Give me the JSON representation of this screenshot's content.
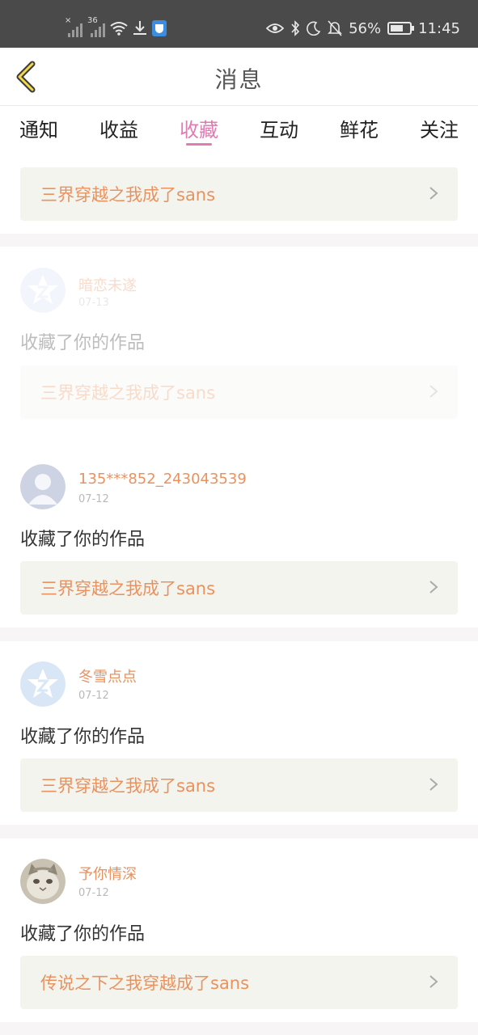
{
  "status_bar": {
    "signal1_tag": "×",
    "signal2_tag": "36",
    "battery": "56%",
    "time": "11:45",
    "icons": [
      "signal-icon",
      "signal-icon",
      "wifi-icon",
      "download-icon",
      "shield-app-icon",
      "eye-icon",
      "bluetooth-icon",
      "moon-icon",
      "mute-bell-icon",
      "battery-icon"
    ]
  },
  "header": {
    "title": "消息",
    "back_icon": "back-chevron-icon"
  },
  "tabs": [
    {
      "label": "通知",
      "active": false
    },
    {
      "label": "收益",
      "active": false
    },
    {
      "label": "收藏",
      "active": true
    },
    {
      "label": "互动",
      "active": false
    },
    {
      "label": "鲜花",
      "active": false
    },
    {
      "label": "关注",
      "active": false
    }
  ],
  "colors": {
    "accent_pink": "#e07bb3",
    "orange_text": "#e8925f",
    "link_bg": "#f4f4ef"
  },
  "top_item": {
    "work_title": "三界穿越之我成了sans"
  },
  "messages": [
    {
      "username": "暗恋未遂",
      "date": "07-13",
      "action": "收藏了你的作品",
      "work_title": "三界穿越之我成了sans",
      "avatar": "default-star-avatar"
    },
    {
      "username": "135***852_243043539",
      "date": "07-12",
      "action": "收藏了你的作品",
      "work_title": "三界穿越之我成了sans",
      "avatar": "default-person-avatar"
    },
    {
      "username": "冬雪点点",
      "date": "07-12",
      "action": "收藏了你的作品",
      "work_title": "三界穿越之我成了sans",
      "avatar": "default-star-avatar"
    },
    {
      "username": "予你情深",
      "date": "07-12",
      "action": "收藏了你的作品",
      "work_title": "传说之下之我穿越成了sans",
      "avatar": "cat-photo-avatar"
    }
  ]
}
